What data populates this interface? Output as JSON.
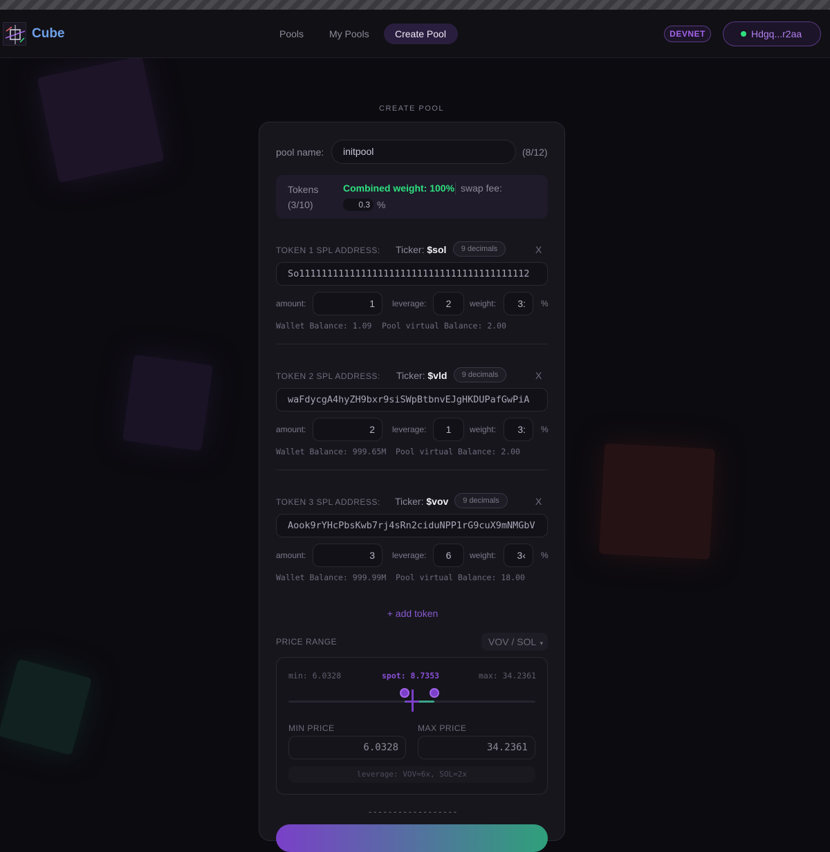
{
  "header": {
    "brand": "Cube",
    "nav": [
      {
        "label": "Pools",
        "active": false
      },
      {
        "label": "My Pools",
        "active": false
      },
      {
        "label": "Create Pool",
        "active": true
      }
    ],
    "network_badge": "DEVNET",
    "wallet_label": "Hdgq...r2aa",
    "wallet_status_color": "#2ee07f"
  },
  "page": {
    "title": "CREATE POOL"
  },
  "form": {
    "pool_name_label": "pool name:",
    "pool_name_value": "initpool",
    "pool_name_counter": "(8/12)",
    "tokens_label": "Tokens",
    "tokens_count": "(3/10)",
    "combined_weight": "Combined weight: 100%",
    "swap_fee_label": "swap fee:",
    "swap_fee_value": "0.3",
    "swap_fee_unit": "%"
  },
  "tokens": [
    {
      "header": "TOKEN 1 SPL ADDRESS:",
      "ticker_label": "Ticker:",
      "ticker": "$sol",
      "decimals": "9 decimals",
      "remove": "X",
      "address": "So11111111111111111111111111111111111111112",
      "amount_label": "amount:",
      "amount": "1",
      "leverage_label": "leverage:",
      "leverage": "2",
      "weight_label": "weight:",
      "weight": "3:",
      "weight_unit": "%",
      "wallet_balance": "Wallet Balance: 1.09",
      "pool_balance": "Pool virtual Balance: 2.00"
    },
    {
      "header": "TOKEN 2 SPL ADDRESS:",
      "ticker_label": "Ticker:",
      "ticker": "$vld",
      "decimals": "9 decimals",
      "remove": "X",
      "address": "waFdycgA4hyZH9bxr9siSWpBtbnvEJgHKDUPafGwPiA",
      "amount_label": "amount:",
      "amount": "2",
      "leverage_label": "leverage:",
      "leverage": "1",
      "weight_label": "weight:",
      "weight": "3:",
      "weight_unit": "%",
      "wallet_balance": "Wallet Balance: 999.65M",
      "pool_balance": "Pool virtual Balance: 2.00"
    },
    {
      "header": "TOKEN 3 SPL ADDRESS:",
      "ticker_label": "Ticker:",
      "ticker": "$vov",
      "decimals": "9 decimals",
      "remove": "X",
      "address": "Aook9rYHcPbsKwb7rj4sRn2ciduNPP1rG9cuX9mNMGbV",
      "amount_label": "amount:",
      "amount": "3",
      "leverage_label": "leverage:",
      "leverage": "6",
      "weight_label": "weight:",
      "weight": "3‹",
      "weight_unit": "%",
      "wallet_balance": "Wallet Balance: 999.99M",
      "pool_balance": "Pool virtual Balance: 18.00"
    }
  ],
  "add_token": "+ add token",
  "price_range": {
    "label": "PRICE RANGE",
    "pair": "VOV / SOL",
    "min_text": "min: 6.0328",
    "spot_text": "spot: 8.7353",
    "max_text": "max: 34.2361",
    "min_price_label": "MIN PRICE",
    "max_price_label": "MAX PRICE",
    "min_price": "6.0328",
    "max_price": "34.2361",
    "leverage_note": "leverage: VOV=6x, SOL=2x",
    "range_min_fraction": 0.47,
    "range_max_fraction": 0.59,
    "spot_fraction": 0.5
  },
  "divider_text": "------------------",
  "colors": {
    "accent_purple": "#a463ea",
    "accent_green": "#2ee07f",
    "background": "#0c0b10"
  }
}
